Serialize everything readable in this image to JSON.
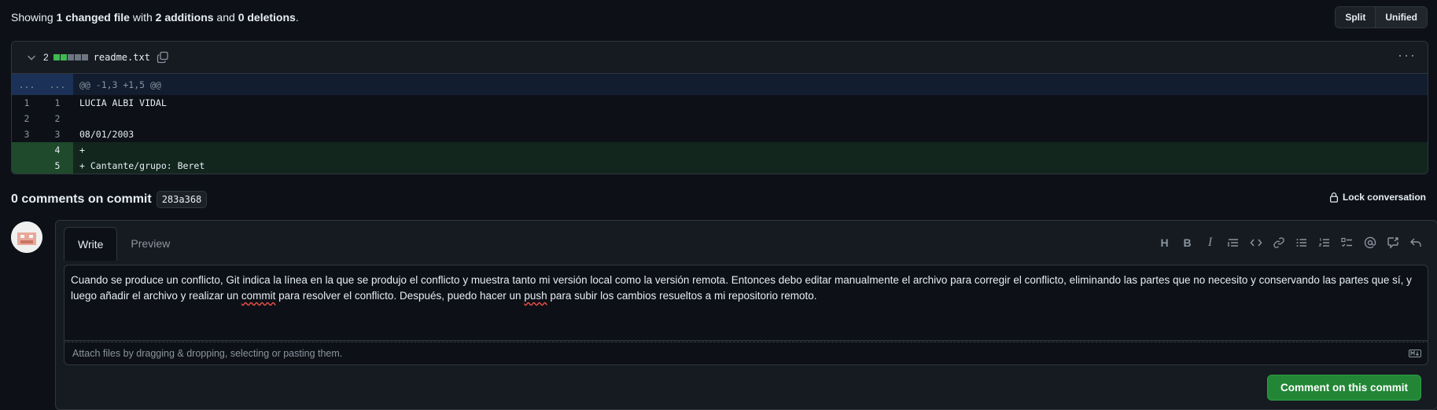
{
  "summary": {
    "prefix": "Showing ",
    "changed": "1 changed file",
    "mid1": " with ",
    "additions": "2 additions",
    "mid2": " and ",
    "deletions": "0 deletions",
    "suffix": "."
  },
  "view_toggle": {
    "split": "Split",
    "unified": "Unified"
  },
  "file": {
    "change_count": "2",
    "name": "readme.txt",
    "hunk": {
      "old": "...",
      "new": "...",
      "text": "@@ -1,3 +1,5 @@"
    },
    "lines": [
      {
        "old": "1",
        "new": "1",
        "type": "normal",
        "text": "LUCIA ALBI VIDAL"
      },
      {
        "old": "2",
        "new": "2",
        "type": "normal",
        "text": ""
      },
      {
        "old": "3",
        "new": "3",
        "type": "normal",
        "text": "08/01/2003"
      },
      {
        "old": "",
        "new": "4",
        "type": "add",
        "text": "+ "
      },
      {
        "old": "",
        "new": "5",
        "type": "add",
        "text": "+ Cantante/grupo: Beret"
      }
    ]
  },
  "comments": {
    "title": "0 comments on commit",
    "sha": "283a368",
    "lock_label": "Lock conversation"
  },
  "editor": {
    "tab_write": "Write",
    "tab_preview": "Preview",
    "text_part1": "Cuando se produce un conflicto, Git indica la línea en la que se produjo el conflicto y muestra tanto mi versión local como la versión remota. Entonces debo editar manualmente el archivo para corregir el conflicto, eliminando las partes que no necesito y conservando las partes que sí, y luego añadir el archivo y realizar un ",
    "text_commit": "commit",
    "text_part2": " para resolver el conflicto. Después, puedo hacer un ",
    "text_push": "push",
    "text_part3": " para subir los cambios resueltos a mi repositorio remoto.",
    "attach_hint": "Attach files by dragging & dropping, selecting or pasting them.",
    "submit_label": "Comment on this commit"
  },
  "colors": {
    "background": "#0d1117",
    "addition": "#3fb950",
    "primary_button": "#238636"
  }
}
